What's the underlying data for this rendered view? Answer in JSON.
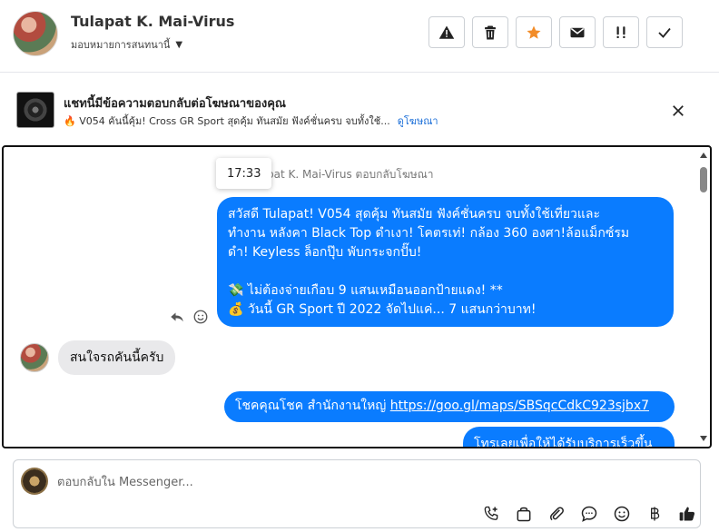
{
  "header": {
    "user_name": "Tulapat K. Mai-Virus",
    "assign_label": "มอบหมายการสนทนานี้",
    "actions": [
      {
        "icon": "warning-icon"
      },
      {
        "icon": "trash-icon"
      },
      {
        "icon": "star-icon",
        "color": "#f28c28"
      },
      {
        "icon": "envelope-icon"
      },
      {
        "icon": "priority-icon"
      },
      {
        "icon": "check-icon"
      }
    ]
  },
  "ad_banner": {
    "title": "แชทนี้มีข้อความตอบกลับต่อโฆษณาของคุณ",
    "subtitle": "🔥 V054 คันนี้คุ้ม! Cross GR Sport สุดคุ้ม ทันสมัย ฟังค์ชั่นครบ จบทั้งใช้...",
    "link_label": "ดูโฆษณา"
  },
  "conversation": {
    "time_tooltip": "17:33",
    "reply_note": "pat K. Mai-Virus ตอบกลับโฆษณา",
    "messages": {
      "outgoing_1": {
        "line1": "สวัสดี Tulapat!   V054 สุดคุ้ม ทันสมัย ฟังค์ชั่นครบ จบทั้งใช้เที่ยวและ",
        "line2": "ทำงาน หลังคา Black Top ดำเงา! โคตรเท่! กล้อง 360 องศา!ล้อแม็กซ์รม",
        "line3": "ดำ! Keyless ล็อกปุ๊บ พับกระจกปั๊บ!",
        "line4": "💸 ไม่ต้องจ่ายเกือบ 9 แสนเหมือนออกป้ายแดง! **",
        "line5": "💰 วันนี้ GR Sport ปี 2022 จัดไปแค่... 7 แสนกว่าบาท!"
      },
      "incoming_1": "สนใจรถคันนี้ครับ",
      "outgoing_2": {
        "text": "โชคคุณโชค สำนักงานใหญ่ ",
        "url": "https://goo.gl/maps/SBSqcCdkC923sjbx7"
      },
      "outgoing_3": "โทรเลยเพื่อให้ได้รับบริการเร็วขึ้น"
    },
    "bubble_color": "#0a7cff"
  },
  "composer": {
    "placeholder": "ตอบกลับใน Messenger...",
    "tools": [
      "call-add-icon",
      "shopping-bag-icon",
      "paperclip-icon",
      "chat-bubble-icon",
      "smiley-icon",
      "baht-icon",
      "thumbs-up-icon"
    ]
  }
}
